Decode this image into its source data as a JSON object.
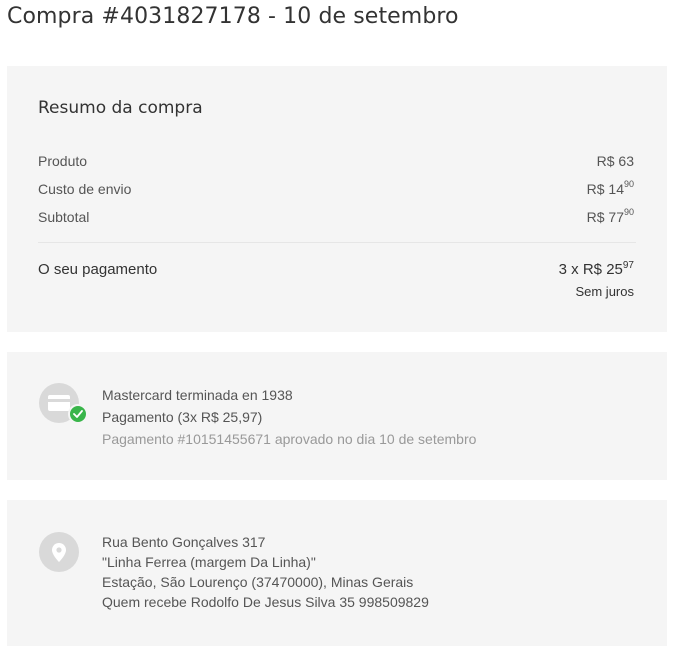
{
  "header": {
    "title": "Compra #4031827178 - 10 de setembro"
  },
  "summary": {
    "title": "Resumo da compra",
    "rows": [
      {
        "label": "Produto",
        "currency": "R$",
        "whole": "63",
        "cents": ""
      },
      {
        "label": "Custo de envio",
        "currency": "R$",
        "whole": "14",
        "cents": "90"
      },
      {
        "label": "Subtotal",
        "currency": "R$",
        "whole": "77",
        "cents": "90"
      }
    ],
    "payment_label": "O seu pagamento",
    "installments_prefix": "3 x R$",
    "installment_whole": "25",
    "installment_cents": "97",
    "interest_note": "Sem juros"
  },
  "payment": {
    "icon": "credit-card-icon",
    "status_icon": "check-icon",
    "card": "Mastercard terminada en 1938",
    "detail": "Pagamento (3x R$ 25,97)",
    "approval": "Pagamento #10151455671 aprovado no dia 10 de setembro"
  },
  "address": {
    "icon": "location-pin-icon",
    "street": "Rua Bento Gonçalves 317",
    "reference": "\"Linha Ferrea (margem Da Linha)\"",
    "city": "Estação, São Lourenço (37470000), Minas Gerais",
    "recipient": "Quem recebe Rodolfo De Jesus Silva 35 998509829"
  },
  "colors": {
    "card_bg": "#f5f5f5",
    "icon_bg": "#d9d9d9",
    "success": "#39b54a"
  }
}
